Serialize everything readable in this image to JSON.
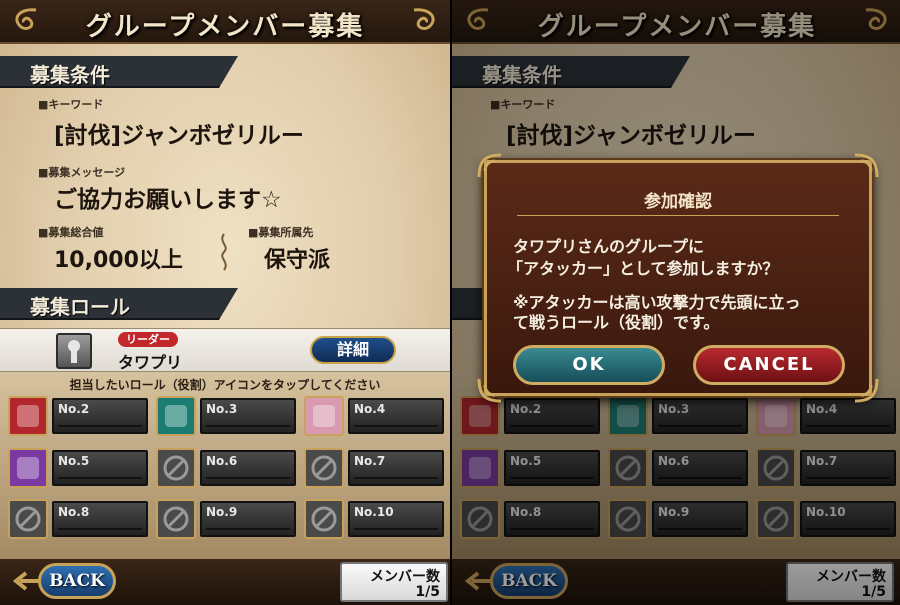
{
  "header": {
    "title": "グループメンバー募集"
  },
  "conditions": {
    "section_label": "募集条件",
    "keyword_label": "■キーワード",
    "keyword_value": "[討伐]ジャンボゼリルー",
    "message_label": "■募集メッセージ",
    "message_value": "ご協力お願いします☆",
    "total_label": "■募集総合値",
    "total_value": "10,000以上",
    "affiliation_label": "■募集所属先",
    "affiliation_value": "保守派"
  },
  "roles": {
    "section_label": "募集ロール",
    "leader_badge": "リーダー",
    "leader_name": "タワプリ",
    "detail_button": "詳細",
    "hint": "担当したいロール（役割）アイコンをタップしてください",
    "slots": [
      {
        "label": "No.2",
        "icon": "attacker-swords-icon",
        "color": "#b3262b"
      },
      {
        "label": "No.3",
        "icon": "defender-shield-icon",
        "color": "#1d7c72"
      },
      {
        "label": "No.4",
        "icon": "healer-heart-icon",
        "color": "#d89ab0"
      },
      {
        "label": "No.5",
        "icon": "support-group-icon",
        "color": "#7a3aa2"
      },
      {
        "label": "No.6",
        "icon": "empty-slot-icon",
        "color": "#4a4a4a"
      },
      {
        "label": "No.7",
        "icon": "empty-slot-icon",
        "color": "#4a4a4a"
      },
      {
        "label": "No.8",
        "icon": "empty-slot-icon",
        "color": "#4a4a4a"
      },
      {
        "label": "No.9",
        "icon": "empty-slot-icon",
        "color": "#4a4a4a"
      },
      {
        "label": "No.10",
        "icon": "empty-slot-icon",
        "color": "#4a4a4a"
      }
    ]
  },
  "footer": {
    "back_button": "BACK",
    "member_label": "メンバー数",
    "member_count": "1/5"
  },
  "dialog": {
    "title": "参加確認",
    "line1": "タワプリさんのグループに",
    "line2": "「アタッカー」として参加しますか？",
    "note1": "※アタッカーは高い攻撃力で先頭に立っ",
    "note2": "て戦うロール（役割）です。",
    "ok_button": "OK",
    "cancel_button": "CANCEL"
  }
}
